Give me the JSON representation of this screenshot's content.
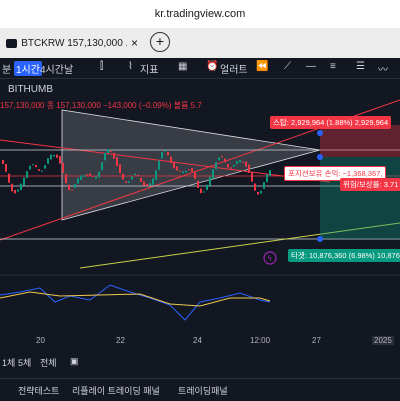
{
  "browser": {
    "url": "kr.tradingview.com",
    "tab_title": "BTCKRW 157,130,000 ...",
    "tab_close": "×",
    "new_tab": "+"
  },
  "toolbar": {
    "interval_min": "분",
    "interval_1h": "1시간",
    "interval_4h": "4시간",
    "interval_day": "날",
    "indicators": "지표",
    "alerts": "얼러트"
  },
  "chart": {
    "symbol": "BITHUMB",
    "price_info": "157,130,000 종 157,130,000 −143,000 (−0.09%) 볼륨 5.7",
    "stop_label": "스탑: 2,929,964 (1.88%) 2,929,964",
    "position_label": "포지션보유 손익: −1,368,367,",
    "risk_label": "위험/보상률: 3.71",
    "target_label": "타겟: 10,876,360 (6.98%) 10,876,360",
    "x_ticks": [
      "20",
      "22",
      "24",
      "12:00",
      "27"
    ],
    "corner_label": "2025"
  },
  "range_bar": {
    "r1": "1체",
    "r2": "5체",
    "all": "전체"
  },
  "panels": {
    "strategy": "전략테스트",
    "replay": "리플레이 트레이딩 패널",
    "trading": "트레이딩패널"
  }
}
